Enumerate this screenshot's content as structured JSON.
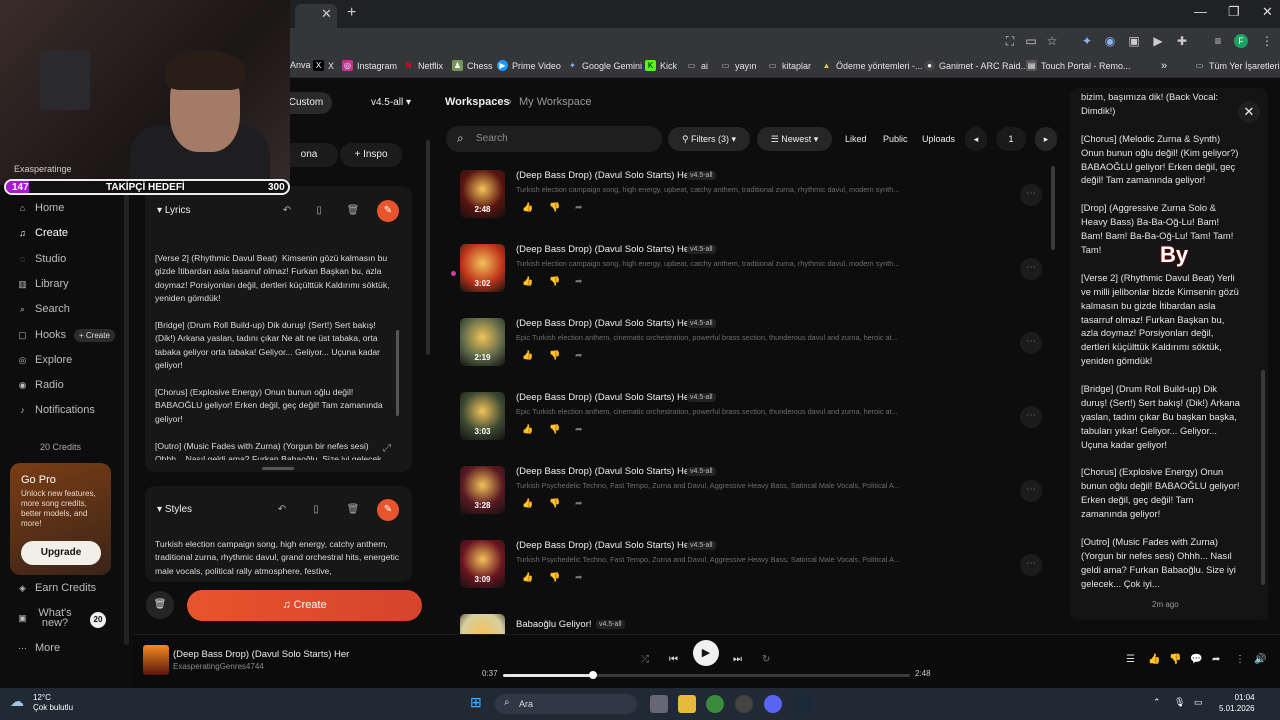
{
  "browser": {
    "new_tab": "+",
    "close": "✕",
    "bookmarks": [
      {
        "label": "Anva",
        "x": 0
      },
      {
        "label": "X"
      },
      {
        "label": "Instagram"
      },
      {
        "label": "Netflix"
      },
      {
        "label": "Chess"
      },
      {
        "label": "Prime Video"
      },
      {
        "label": "Google Gemini"
      },
      {
        "label": "Kick"
      },
      {
        "label": "ai"
      },
      {
        "label": "yayın"
      },
      {
        "label": "kitaplar"
      },
      {
        "label": "Ödeme yöntemleri -..."
      },
      {
        "label": "Ganimet - ARC Raid..."
      },
      {
        "label": "Touch Portal - Remo..."
      }
    ],
    "bookmarks_more": "»",
    "all_bookmarks": "Tüm Yer İşaretleri",
    "profile_initial": "F"
  },
  "overlay": {
    "goal_current": "147",
    "goal_label": "TAKİPÇİ HEDEFİ",
    "goal_target": "300",
    "goal_fraction": 0.49,
    "channel": "Exasperatinge",
    "by_text": "By"
  },
  "nav": {
    "items": [
      "Home",
      "Create",
      "Studio",
      "Library",
      "Search",
      "Hooks",
      "Explore",
      "Radio",
      "Notifications"
    ],
    "hooks_pill": "+ Create",
    "credits": "20 Credits",
    "go_pro_title": "Go Pro",
    "go_pro_desc": "Unlock new features, more song credits, better models, and more!",
    "upgrade": "Upgrade",
    "earn": "Earn Credits",
    "whats_new": "What's new?",
    "whats_new_count": "20",
    "more": "More"
  },
  "create": {
    "custom": "Custom",
    "model": "v4.5-all",
    "persona": "ona",
    "inspo": "+ Inspo",
    "lyrics_label": "Lyrics",
    "lyrics": "[Verse 2] (Rhythmic Davul Beat)  Kimsenin gözü kalmasın bu gizde İtibardan asla tasarruf olmaz! Furkan Başkan bu, azla doymaz! Porsiyonları değil, dertleri küçülttük Kaldırımı söktük, yeniden gömdük!\n\n[Bridge] (Drum Roll Build-up) Dik duruş! (Sert!) Sert bakış! (Dik!) Arkana yaslan, tadını çıkar Ne alt ne üst tabaka, orta tabaka geliyor orta tabaka! Geliyor... Geliyor... Uçuna kadar geliyor!\n\n[Chorus] (Explosive Energy) Onun bunun oğlu değil! BABAOĞLU geliyor! Erken değil, geç değil! Tam zamanında geliyor!\n\n[Outro] (Music Fades with Zurna) (Yorgun bir nefes sesi) Ohhh... Nasıl geldi ama? Furkan Babaoğlu. Size iyi gelecek...",
    "styles_label": "Styles",
    "styles": "Turkish election campaign song, high energy, catchy anthem, traditional zurna, rhythmic davul, grand orchestral hits, energetic male vocals, political rally atmosphere, festive,",
    "create_button": "Create"
  },
  "workspace": {
    "root": "Workspaces",
    "sep": "›",
    "name": "My Workspace",
    "search_placeholder": "Search",
    "filters": "Filters (3)",
    "sort": "Newest",
    "liked": "Liked",
    "public": "Public",
    "uploads": "Uploads",
    "page": "1",
    "songs": [
      {
        "title": "(Deep Bass Drop) (Davul Solo Starts) Her",
        "version": "v4.5-all",
        "desc": "Turkish election campaign song, high energy, upbeat, catchy anthem, traditional zurna, rhythmic davul, modern synth...",
        "duration": "2:48",
        "color": "#5a1410"
      },
      {
        "title": "(Deep Bass Drop) (Davul Solo Starts) Her",
        "version": "v4.5-all",
        "desc": "Turkish election campaign song, high energy, upbeat, catchy anthem, traditional zurna, rhythmic davul, modern synth...",
        "duration": "3:02",
        "color": "#c0341a"
      },
      {
        "title": "(Deep Bass Drop) (Davul Solo Starts) Her",
        "version": "v4.5-all",
        "desc": "Epic Turkish election anthem, cinematic orchestration, powerful brass section, thunderous davul and zurna, heroic at...",
        "duration": "2:19",
        "color": "#5e6a4a"
      },
      {
        "title": "(Deep Bass Drop) (Davul Solo Starts) Her",
        "version": "v4.5-all",
        "desc": "Epic Turkish election anthem, cinematic orchestration, powerful brass section, thunderous davul and zurna, heroic at...",
        "duration": "3:03",
        "color": "#3c4a32"
      },
      {
        "title": "(Deep Bass Drop) (Davul Solo Starts) Her",
        "version": "v4.5-all",
        "desc": "Turkish Psychedelic Techno, Fast Tempo, Zurna and Davul, Aggressive Heavy Bass, Satirical Male Vocals, Political A...",
        "duration": "3:28",
        "color": "#5a1a22"
      },
      {
        "title": "(Deep Bass Drop) (Davul Solo Starts) Her",
        "version": "v4.5-all",
        "desc": "Turkish Psychedelic Techno, Fast Tempo, Zurna and Davul, Aggressive Heavy Bass, Satirical Male Vocals, Political A...",
        "duration": "3:09",
        "color": "#6b1420"
      },
      {
        "title": "Babaoğlu Geliyor!",
        "version": "v4.5-all",
        "desc": "",
        "duration": "",
        "color": "#d8cfa0"
      }
    ]
  },
  "rightpanel": {
    "text": "bizim, başımıza dik! (Back Vocal: Dimdik!)\n\n[Chorus] (Melodic Zurna & Synth) Onun bunun oğlu değil! (Kim geliyor?) BABAOĞLU geliyor! Erken değil, geç değil! Tam zamanında geliyor!\n\n[Drop] (Aggressive Zurna Solo & Heavy Bass) Ba-Ba-Oğ-Lu! Bam! Bam! Bam! Ba-Ba-Oğ-Lu! Tam! Tam! Tam!\n\n[Verse 2] (Rhythmic Davul Beat) Yerli ve milli jelibonlar bizde Kimsenin gözü kalmasın bu gizde İtibardan asla tasarruf olmaz! Furkan Başkan bu, azla doymaz! Porsiyonları değil, dertleri küçülttük Kaldırımı söktük, yeniden gömdük!\n\n[Bridge] (Drum Roll Build-up) Dik duruş! (Sert!) Sert bakış! (Dik!) Arkana yaslan, tadını çıkar Bu başkan başka, tabuları yıkar! Geliyor... Geliyor... Uçuna kadar geliyor!\n\n[Chorus] (Explosive Energy) Onun bunun oğlu değil! BABAOĞLU geliyor! Erken değil, geç değil! Tam zamanında geliyor!\n\n[Outro] (Music Fades with Zurna) (Yorgun bir nefes sesi) Ohhh... Nasıl geldi ama? Furkan Babaoğlu. Size iyi gelecek... Çok iyi...",
    "time": "2m ago"
  },
  "player": {
    "title": "(Deep Bass Drop) (Davul Solo Starts) Her",
    "artist": "ExasperatingGenres4744",
    "current": "0:37",
    "total": "2:48",
    "progress": 0.22
  },
  "taskbar": {
    "temp": "12°C",
    "weather": "Çok bulutlu",
    "search": "Ara",
    "time": "01:04",
    "date": "5.01.2026"
  }
}
